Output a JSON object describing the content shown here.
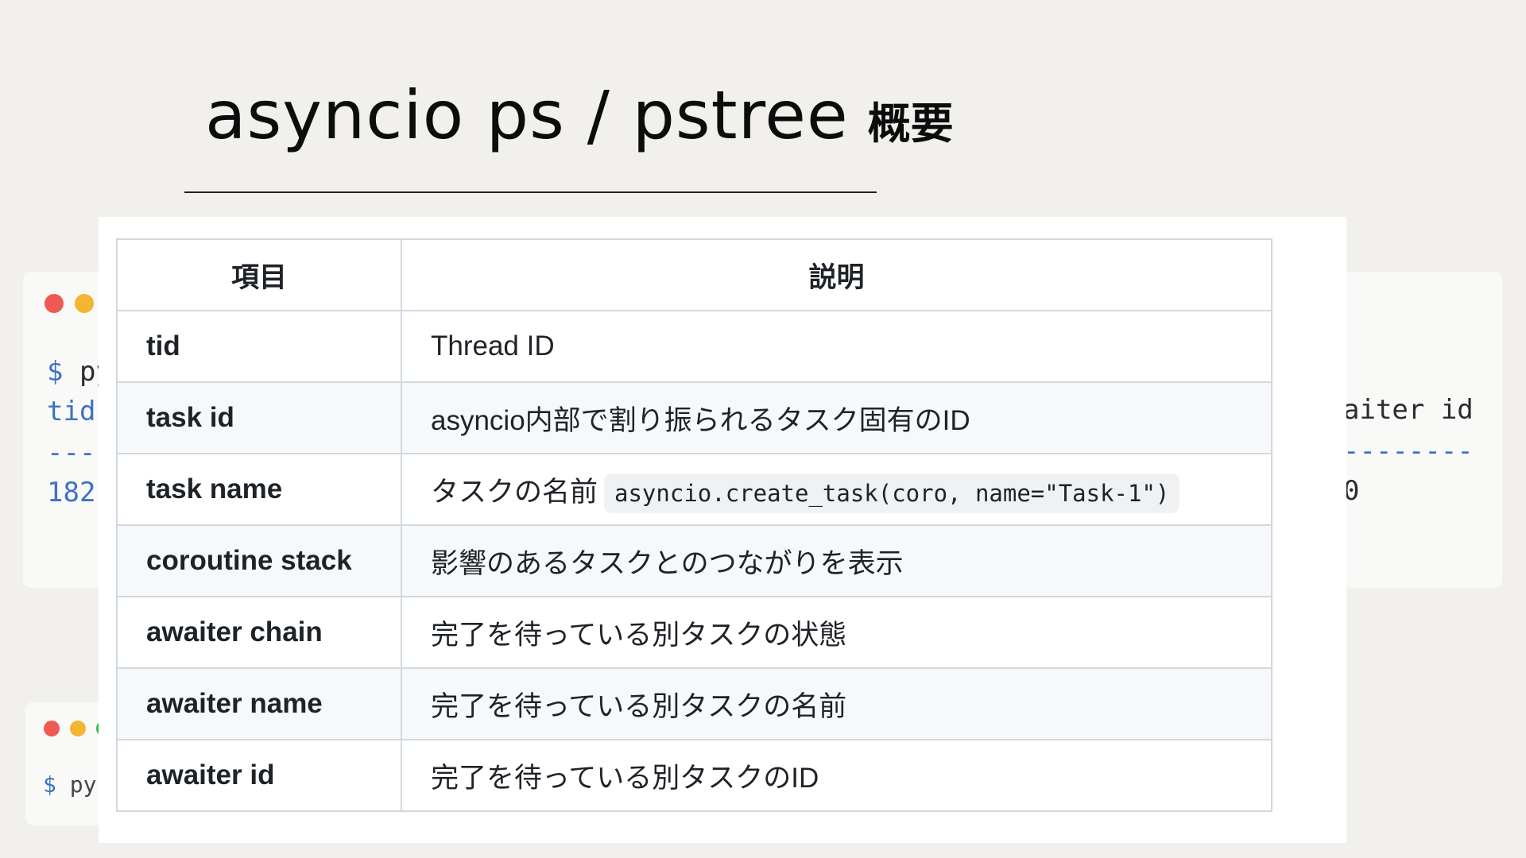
{
  "slide": {
    "title": "asyncio ps / pstree",
    "title_suffix": "概要"
  },
  "background_terminals": {
    "left_top": {
      "prompt": "$",
      "command_fragment": "py",
      "header_fragment": "tid",
      "separator_fragment": "---",
      "value_fragment": "182"
    },
    "left_bottom": {
      "prompt": "$",
      "command_fragment": "py"
    },
    "right": {
      "header_fragment": "aiter id",
      "separator_fragment": "--------",
      "value_fragment": "0"
    }
  },
  "table": {
    "headers": [
      "項目",
      "説明"
    ],
    "rows": [
      {
        "key": "tid",
        "desc": "Thread ID"
      },
      {
        "key": "task id",
        "desc": "asyncio内部で割り振られるタスク固有のID"
      },
      {
        "key": "task name",
        "desc": "タスクの名前",
        "code": "asyncio.create_task(coro, name=\"Task-1\")"
      },
      {
        "key": "coroutine stack",
        "desc": "影響のあるタスクとのつながりを表示"
      },
      {
        "key": "awaiter chain",
        "desc": "完了を待っている別タスクの状態"
      },
      {
        "key": "awaiter name",
        "desc": "完了を待っている別タスクの名前"
      },
      {
        "key": "awaiter id",
        "desc": "完了を待っている別タスクのID"
      }
    ]
  },
  "colors": {
    "background": "#f1f0ed",
    "terminal_blue": "#3d71c4",
    "dot_red": "#ef5a52",
    "dot_yellow": "#f2b632",
    "dot_green": "#2ec14a",
    "table_border": "#d1d9e0",
    "table_stripe": "#f6f8fa"
  }
}
